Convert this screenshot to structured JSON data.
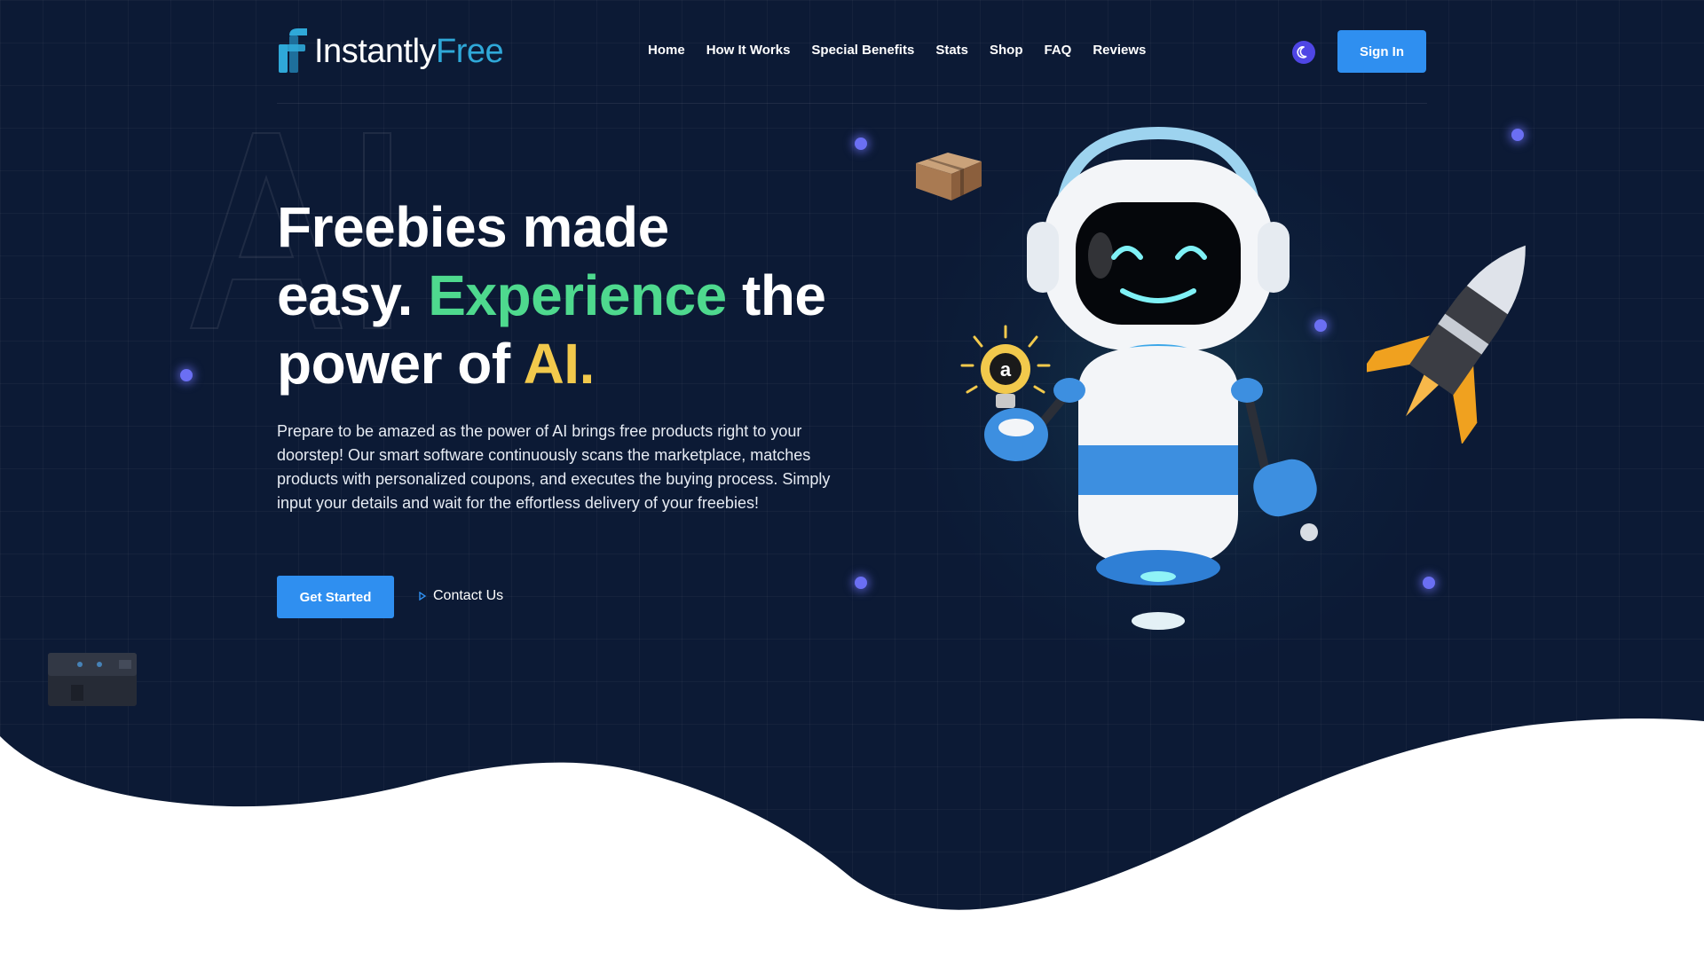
{
  "brand": {
    "name_part1": "Instantly",
    "name_part2": "Free"
  },
  "nav": {
    "items": [
      {
        "label": "Home"
      },
      {
        "label": "How It Works"
      },
      {
        "label": "Special Benefits"
      },
      {
        "label": "Stats"
      },
      {
        "label": "Shop"
      },
      {
        "label": "FAQ"
      },
      {
        "label": "Reviews"
      }
    ],
    "theme_icon": "moon-icon",
    "signin_label": "Sign In"
  },
  "hero": {
    "title_line1": "Freebies made",
    "title_line2_a": "easy.",
    "title_line2_b": "Experience",
    "title_line2_c": "the",
    "title_line3_a": "power of",
    "title_line3_b": "AI.",
    "description": "Prepare to be amazed as the power of AI brings free products right to your doorstep! Our smart software continuously scans the marketplace, matches products with personalized coupons, and executes the buying process. Simply input your details and wait for the effortless delivery of your freebies!",
    "primary_cta": "Get Started",
    "secondary_cta": "Contact Us",
    "secondary_icon": "play-icon",
    "watermark": "AI",
    "robot_badge": "a"
  },
  "colors": {
    "background": "#0c1a35",
    "accent_blue": "#2f8ff0",
    "accent_green": "#4ed98e",
    "accent_gold": "#f2c94c",
    "brand_teal": "#2fa8d8",
    "toggle": "#4f46e5"
  },
  "illustrations": [
    "robot-mascot",
    "lightbulb",
    "rocket",
    "package-box",
    "device-box"
  ]
}
